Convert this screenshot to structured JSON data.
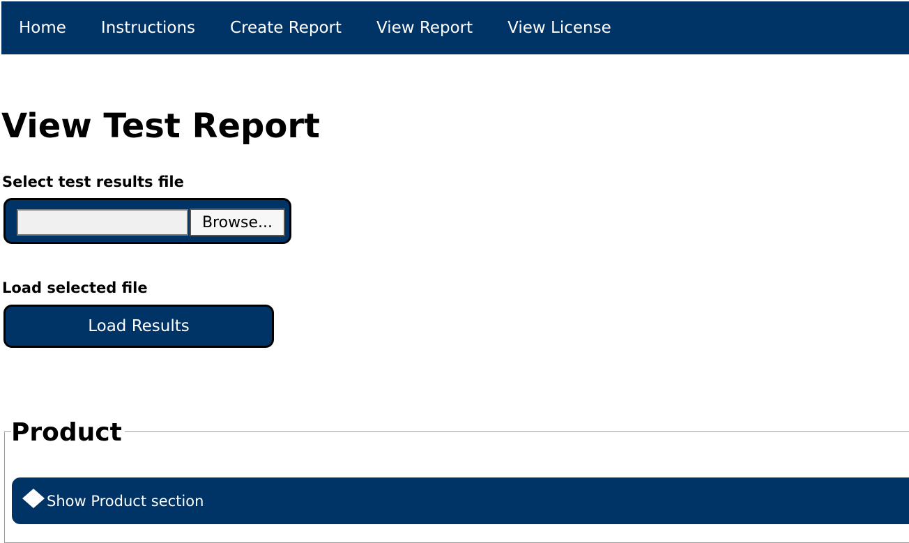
{
  "nav": {
    "items": [
      {
        "label": "Home"
      },
      {
        "label": "Instructions"
      },
      {
        "label": "Create Report"
      },
      {
        "label": "View Report"
      },
      {
        "label": "View License"
      }
    ]
  },
  "page": {
    "title": "View Test Report"
  },
  "file_select": {
    "label": "Select test results file",
    "value": "",
    "browse_label": "Browse..."
  },
  "load": {
    "label": "Load selected file",
    "button_label": "Load Results"
  },
  "product_section": {
    "legend": "Product",
    "toggle_label": "Show Product section",
    "toggle_icon": "diamond-expand-icon"
  },
  "colors": {
    "primary": "#003366",
    "text_light": "#ffffff",
    "border": "#000000"
  }
}
